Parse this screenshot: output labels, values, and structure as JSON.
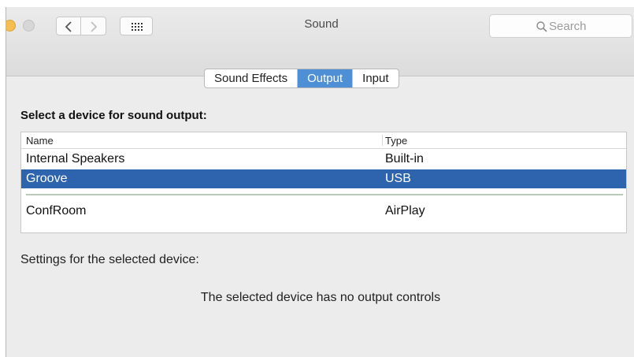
{
  "window": {
    "title": "Sound"
  },
  "toolbar": {
    "back_icon": "chevron-left-icon",
    "forward_icon": "chevron-right-icon",
    "show_all_icon": "grid-icon",
    "search_placeholder": "Search"
  },
  "tabs": [
    {
      "label": "Sound Effects",
      "active": false
    },
    {
      "label": "Output",
      "active": true
    },
    {
      "label": "Input",
      "active": false
    }
  ],
  "output": {
    "heading": "Select a device for sound output:",
    "columns": {
      "name": "Name",
      "type": "Type"
    },
    "devices": [
      {
        "name": "Internal Speakers",
        "type": "Built-in",
        "selected": false
      },
      {
        "name": "Groove",
        "type": "USB",
        "selected": true
      },
      {
        "name": "ConfRoom",
        "type": "AirPlay",
        "selected": false
      }
    ],
    "settings_label": "Settings for the selected device:",
    "no_controls_message": "The selected device has no output controls"
  },
  "colors": {
    "selected_row": "#2e64ad",
    "active_tab": "#4f8fd6"
  }
}
